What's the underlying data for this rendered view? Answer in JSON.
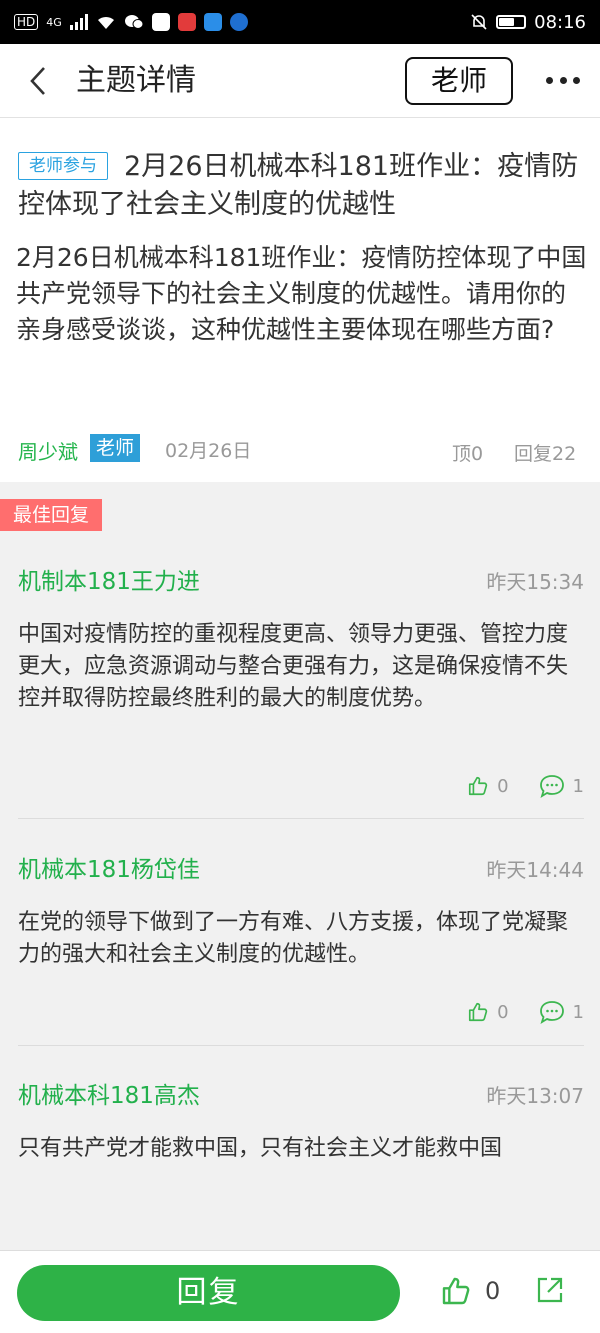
{
  "status_bar": {
    "network": "4G",
    "hd": "HD",
    "time": "08:16",
    "battery_level": 0.6
  },
  "header": {
    "title": "主题详情",
    "role_button": "老师"
  },
  "topic": {
    "tag": "老师参与",
    "title": "2月26日机械本科181班作业：疫情防控体现了社会主义制度的优越性",
    "body": "2月26日机械本科181班作业：疫情防控体现了中国共产党领导下的社会主义制度的优越性。请用你的亲身感受谈谈，这种优越性主要体现在哪些方面?",
    "author": "周少斌",
    "author_role": "老师",
    "date": "02月26日",
    "likes_label": "顶0",
    "replies_label": "回复22"
  },
  "best_label": "最佳回复",
  "replies": [
    {
      "name": "机制本181王力进",
      "time": "昨天15:34",
      "text": "中国对疫情防控的重视程度更高、领导力更强、管控力度更大，应急资源调动与整合更强有力，这是确保疫情不失控并取得防控最终胜利的最大的制度优势。",
      "likes": "0",
      "comments": "1"
    },
    {
      "name": "机械本181杨岱佳",
      "time": "昨天14:44",
      "text": "在党的领导下做到了一方有难、八方支援，体现了党凝聚力的强大和社会主义制度的优越性。",
      "likes": "0",
      "comments": "1"
    },
    {
      "name": "机械本科181高杰",
      "time": "昨天13:07",
      "text": "只有共产党才能救中国，只有社会主义才能救中国"
    }
  ],
  "bottom_bar": {
    "reply_button": "回复",
    "like_count": "0"
  },
  "colors": {
    "accent_green": "#2eb247",
    "teacher_blue": "#2e9fd8",
    "best_red": "#ff6e6e"
  }
}
